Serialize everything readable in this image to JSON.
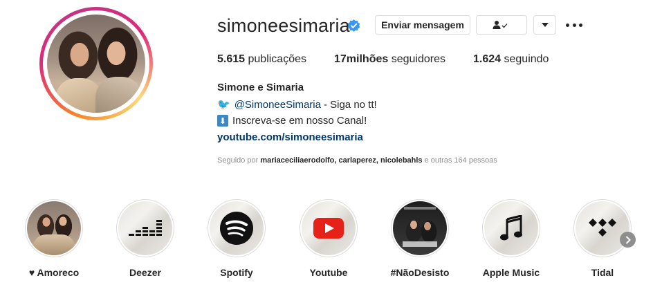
{
  "profile": {
    "username": "simoneesimaria",
    "verified": true,
    "buttons": {
      "message": "Enviar mensagem"
    },
    "stats": {
      "posts_count": "5.615",
      "posts_label": "publicações",
      "followers_count": "17milhões",
      "followers_label": "seguidores",
      "following_count": "1.624",
      "following_label": "seguindo"
    },
    "full_name": "Simone e Simaria",
    "bio": {
      "line1_emoji": "🐦",
      "line1_mention": "@SimoneeSimaria",
      "line1_text": "- Siga no tt!",
      "line2_emoji": "⬇",
      "line2_text": "Inscreva-se em nosso Canal!",
      "link": "youtube.com/simoneesimaria"
    },
    "followed_by": {
      "prefix": "Seguido por",
      "users": "mariaceciliaerodolfo, carlaperez, nicolebahls",
      "suffix": "e outras 164 pessoas"
    }
  },
  "highlights": [
    {
      "label": "♥ Amoreco",
      "icon": "photo-duo"
    },
    {
      "label": "Deezer",
      "icon": "deezer-icon"
    },
    {
      "label": "Spotify",
      "icon": "spotify-icon"
    },
    {
      "label": "Youtube",
      "icon": "youtube-icon"
    },
    {
      "label": "#NãoDesisto",
      "icon": "album-cover"
    },
    {
      "label": "Apple Music",
      "icon": "music-note-icon"
    },
    {
      "label": "Tidal",
      "icon": "tidal-icon"
    }
  ],
  "colors": {
    "link": "#00376b",
    "verified": "#3897f0",
    "youtube_red": "#e62117",
    "secondary_text": "#8e8e8e"
  }
}
